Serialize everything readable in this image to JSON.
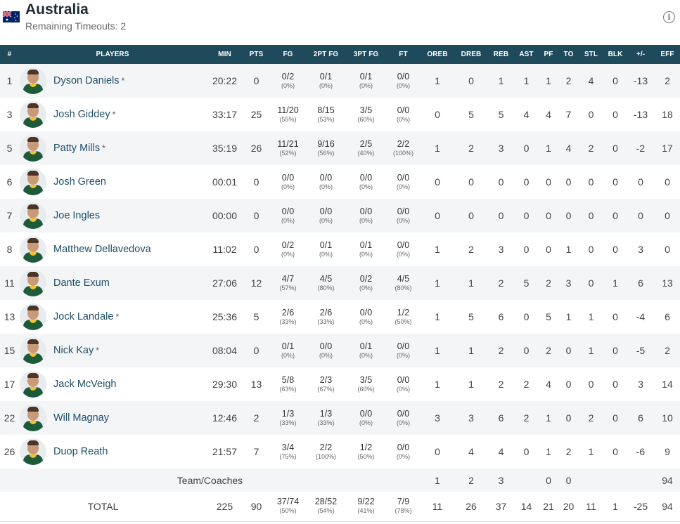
{
  "team": {
    "name": "Australia",
    "timeouts_text": "Remaining Timeouts: 2",
    "flag_icon": "australia-flag-icon",
    "info_icon": "i"
  },
  "columns": [
    "#",
    "PLAYERS",
    "MIN",
    "PTS",
    "FG",
    "2PT FG",
    "3PT FG",
    "FT",
    "OREB",
    "DREB",
    "REB",
    "AST",
    "PF",
    "TO",
    "STL",
    "BLK",
    "+/-",
    "EFF"
  ],
  "players": [
    {
      "num": "1",
      "name": "Dyson Daniels",
      "starter": "*",
      "min": "20:22",
      "pts": "0",
      "fg": "0/2",
      "fg_pct": "(0%)",
      "fg2": "0/1",
      "fg2_pct": "(0%)",
      "fg3": "0/1",
      "fg3_pct": "(0%)",
      "ft": "0/0",
      "ft_pct": "(0%)",
      "oreb": "1",
      "dreb": "0",
      "reb": "1",
      "ast": "1",
      "pf": "1",
      "to": "2",
      "stl": "4",
      "blk": "0",
      "pm": "-13",
      "eff": "2"
    },
    {
      "num": "3",
      "name": "Josh Giddey",
      "starter": "*",
      "min": "33:17",
      "pts": "25",
      "fg": "11/20",
      "fg_pct": "(55%)",
      "fg2": "8/15",
      "fg2_pct": "(53%)",
      "fg3": "3/5",
      "fg3_pct": "(60%)",
      "ft": "0/0",
      "ft_pct": "(0%)",
      "oreb": "0",
      "dreb": "5",
      "reb": "5",
      "ast": "4",
      "pf": "4",
      "to": "7",
      "stl": "0",
      "blk": "0",
      "pm": "-13",
      "eff": "18"
    },
    {
      "num": "5",
      "name": "Patty Mills",
      "starter": "*",
      "min": "35:19",
      "pts": "26",
      "fg": "11/21",
      "fg_pct": "(52%)",
      "fg2": "9/16",
      "fg2_pct": "(56%)",
      "fg3": "2/5",
      "fg3_pct": "(40%)",
      "ft": "2/2",
      "ft_pct": "(100%)",
      "oreb": "1",
      "dreb": "2",
      "reb": "3",
      "ast": "0",
      "pf": "1",
      "to": "4",
      "stl": "2",
      "blk": "0",
      "pm": "-2",
      "eff": "17"
    },
    {
      "num": "6",
      "name": "Josh Green",
      "starter": "",
      "min": "00:01",
      "pts": "0",
      "fg": "0/0",
      "fg_pct": "(0%)",
      "fg2": "0/0",
      "fg2_pct": "(0%)",
      "fg3": "0/0",
      "fg3_pct": "(0%)",
      "ft": "0/0",
      "ft_pct": "(0%)",
      "oreb": "0",
      "dreb": "0",
      "reb": "0",
      "ast": "0",
      "pf": "0",
      "to": "0",
      "stl": "0",
      "blk": "0",
      "pm": "0",
      "eff": "0"
    },
    {
      "num": "7",
      "name": "Joe Ingles",
      "starter": "",
      "min": "00:00",
      "pts": "0",
      "fg": "0/0",
      "fg_pct": "(0%)",
      "fg2": "0/0",
      "fg2_pct": "(0%)",
      "fg3": "0/0",
      "fg3_pct": "(0%)",
      "ft": "0/0",
      "ft_pct": "(0%)",
      "oreb": "0",
      "dreb": "0",
      "reb": "0",
      "ast": "0",
      "pf": "0",
      "to": "0",
      "stl": "0",
      "blk": "0",
      "pm": "0",
      "eff": "0"
    },
    {
      "num": "8",
      "name": "Matthew Dellavedova",
      "starter": "",
      "min": "11:02",
      "pts": "0",
      "fg": "0/2",
      "fg_pct": "(0%)",
      "fg2": "0/1",
      "fg2_pct": "(0%)",
      "fg3": "0/1",
      "fg3_pct": "(0%)",
      "ft": "0/0",
      "ft_pct": "(0%)",
      "oreb": "1",
      "dreb": "2",
      "reb": "3",
      "ast": "0",
      "pf": "0",
      "to": "1",
      "stl": "0",
      "blk": "0",
      "pm": "3",
      "eff": "0"
    },
    {
      "num": "11",
      "name": "Dante Exum",
      "starter": "",
      "min": "27:06",
      "pts": "12",
      "fg": "4/7",
      "fg_pct": "(57%)",
      "fg2": "4/5",
      "fg2_pct": "(80%)",
      "fg3": "0/2",
      "fg3_pct": "(0%)",
      "ft": "4/5",
      "ft_pct": "(80%)",
      "oreb": "1",
      "dreb": "1",
      "reb": "2",
      "ast": "5",
      "pf": "2",
      "to": "3",
      "stl": "0",
      "blk": "1",
      "pm": "6",
      "eff": "13"
    },
    {
      "num": "13",
      "name": "Jock Landale",
      "starter": "*",
      "min": "25:36",
      "pts": "5",
      "fg": "2/6",
      "fg_pct": "(33%)",
      "fg2": "2/6",
      "fg2_pct": "(33%)",
      "fg3": "0/0",
      "fg3_pct": "(0%)",
      "ft": "1/2",
      "ft_pct": "(50%)",
      "oreb": "1",
      "dreb": "5",
      "reb": "6",
      "ast": "0",
      "pf": "5",
      "to": "1",
      "stl": "1",
      "blk": "0",
      "pm": "-4",
      "eff": "6"
    },
    {
      "num": "15",
      "name": "Nick Kay",
      "starter": "*",
      "min": "08:04",
      "pts": "0",
      "fg": "0/1",
      "fg_pct": "(0%)",
      "fg2": "0/0",
      "fg2_pct": "(0%)",
      "fg3": "0/1",
      "fg3_pct": "(0%)",
      "ft": "0/0",
      "ft_pct": "(0%)",
      "oreb": "1",
      "dreb": "1",
      "reb": "2",
      "ast": "0",
      "pf": "2",
      "to": "0",
      "stl": "1",
      "blk": "0",
      "pm": "-5",
      "eff": "2"
    },
    {
      "num": "17",
      "name": "Jack McVeigh",
      "starter": "",
      "min": "29:30",
      "pts": "13",
      "fg": "5/8",
      "fg_pct": "(63%)",
      "fg2": "2/3",
      "fg2_pct": "(67%)",
      "fg3": "3/5",
      "fg3_pct": "(60%)",
      "ft": "0/0",
      "ft_pct": "(0%)",
      "oreb": "1",
      "dreb": "1",
      "reb": "2",
      "ast": "2",
      "pf": "4",
      "to": "0",
      "stl": "0",
      "blk": "0",
      "pm": "3",
      "eff": "14"
    },
    {
      "num": "22",
      "name": "Will Magnay",
      "starter": "",
      "min": "12:46",
      "pts": "2",
      "fg": "1/3",
      "fg_pct": "(33%)",
      "fg2": "1/3",
      "fg2_pct": "(33%)",
      "fg3": "0/0",
      "fg3_pct": "(0%)",
      "ft": "0/0",
      "ft_pct": "(0%)",
      "oreb": "3",
      "dreb": "3",
      "reb": "6",
      "ast": "2",
      "pf": "1",
      "to": "0",
      "stl": "2",
      "blk": "0",
      "pm": "6",
      "eff": "10"
    },
    {
      "num": "26",
      "name": "Duop Reath",
      "starter": "",
      "min": "21:57",
      "pts": "7",
      "fg": "3/4",
      "fg_pct": "(75%)",
      "fg2": "2/2",
      "fg2_pct": "(100%)",
      "fg3": "1/2",
      "fg3_pct": "(50%)",
      "ft": "0/0",
      "ft_pct": "(0%)",
      "oreb": "0",
      "dreb": "4",
      "reb": "4",
      "ast": "0",
      "pf": "1",
      "to": "2",
      "stl": "1",
      "blk": "0",
      "pm": "-6",
      "eff": "9"
    }
  ],
  "team_coaches": {
    "label": "Team/Coaches",
    "oreb": "1",
    "dreb": "2",
    "reb": "3",
    "pf": "0",
    "to": "0",
    "eff": "94"
  },
  "total": {
    "label": "TOTAL",
    "min": "225",
    "pts": "90",
    "fg": "37/74",
    "fg_pct": "(50%)",
    "fg2": "28/52",
    "fg2_pct": "(54%)",
    "fg3": "9/22",
    "fg3_pct": "(41%)",
    "ft": "7/9",
    "ft_pct": "(78%)",
    "oreb": "11",
    "dreb": "26",
    "reb": "37",
    "ast": "14",
    "pf": "21",
    "to": "20",
    "stl": "11",
    "blk": "1",
    "pm": "-25",
    "eff": "94"
  }
}
